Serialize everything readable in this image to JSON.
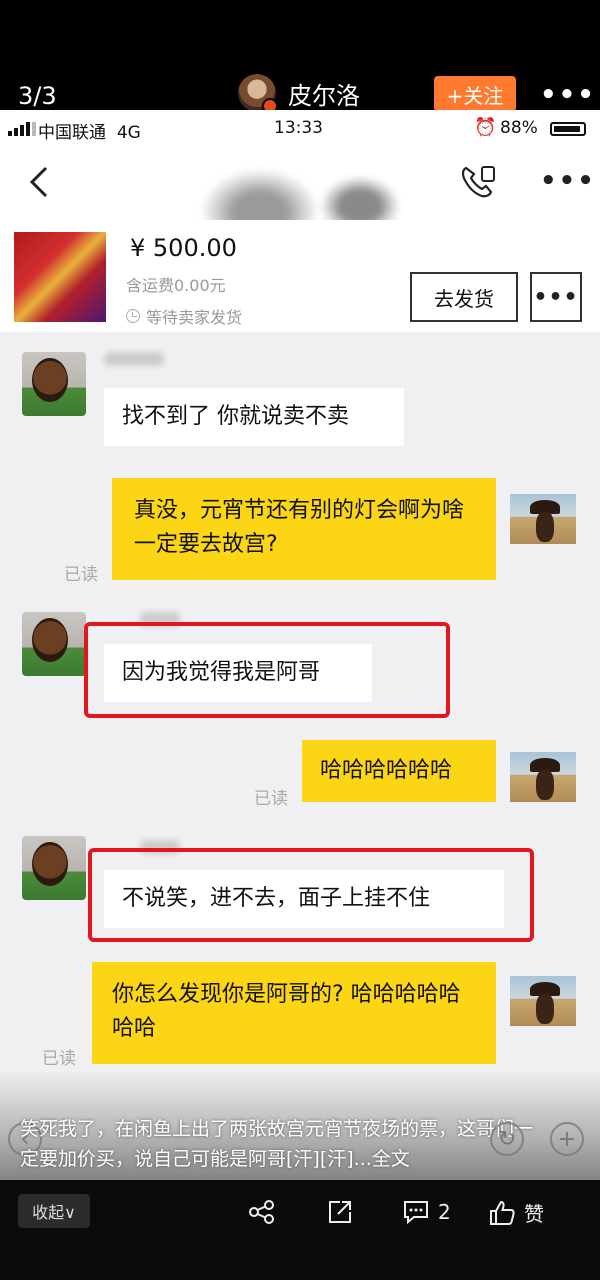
{
  "viewer": {
    "page_counter": "3/3",
    "author_name": "皮尔洛",
    "follow_label": "+关注",
    "more_label": "•••"
  },
  "status_bar": {
    "carrier": "中国联通",
    "network": "4G",
    "time": "13:33",
    "battery": "88%"
  },
  "chat_header": {
    "back_icon": "chevron-left-icon",
    "call_icon": "phone-call-icon",
    "more_label": "•••"
  },
  "order": {
    "price": "¥ 500.00",
    "shipping": "含运费0.00元",
    "status": "等待卖家发货",
    "ship_button": "去发货",
    "more_button": "•••"
  },
  "messages": [
    {
      "side": "left",
      "text": "找不到了 你就说卖不卖",
      "highlighted": false
    },
    {
      "side": "right",
      "text": "真没，元宵节还有别的灯会啊为啥一定要去故宫?",
      "read": "已读"
    },
    {
      "side": "left",
      "text": "因为我觉得我是阿哥",
      "highlighted": true
    },
    {
      "side": "right",
      "text": "哈哈哈哈哈哈",
      "read": "已读"
    },
    {
      "side": "left",
      "text": "不说笑，进不去，面子上挂不住",
      "highlighted": true
    },
    {
      "side": "right",
      "text": "你怎么发现你是阿哥的? 哈哈哈哈哈哈哈",
      "read": "已读"
    }
  ],
  "caption": {
    "text": "笑死我了，在闲鱼上出了两张故宫元宵节夜场的票，这哥们一定要加价买，说自己可能是阿哥[汗][汗]...",
    "more": "全文"
  },
  "toolbar": {
    "collapse_label": "收起∨",
    "share_icon": "share-icon",
    "forward_icon": "forward-icon",
    "comment_icon": "comment-icon",
    "comment_count": "2",
    "like_icon": "thumbs-up-icon",
    "like_label": "赞"
  },
  "colors": {
    "accent_orange": "#ff7a2e",
    "bubble_yellow": "#fcd614",
    "highlight_red": "#e2161e"
  }
}
